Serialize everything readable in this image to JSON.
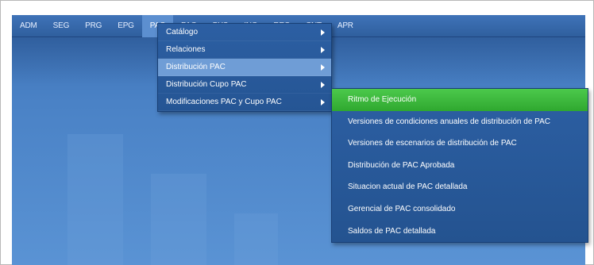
{
  "menubar": {
    "items": [
      {
        "label": "ADM"
      },
      {
        "label": "SEG"
      },
      {
        "label": "PRG"
      },
      {
        "label": "EPG"
      },
      {
        "label": "PAC"
      },
      {
        "label": "PAG"
      },
      {
        "label": "BYS"
      },
      {
        "label": "ING"
      },
      {
        "label": "REC"
      },
      {
        "label": "CNT"
      },
      {
        "label": "APR"
      }
    ],
    "active": "PAC"
  },
  "pac_menu": {
    "items": [
      {
        "label": "Catálogo"
      },
      {
        "label": "Relaciones"
      },
      {
        "label": "Distribución PAC"
      },
      {
        "label": "Distribución Cupo PAC"
      },
      {
        "label": "Modificaciones PAC y Cupo PAC"
      }
    ],
    "selected": "Distribución PAC"
  },
  "submenu": {
    "items": [
      {
        "label": "Ritmo de Ejecución"
      },
      {
        "label": "Versiones de condiciones anuales de distribución de PAC"
      },
      {
        "label": "Versiones de escenarios de distribución de PAC"
      },
      {
        "label": "Distribución de PAC Aprobada"
      },
      {
        "label": "Situacion actual de PAC detallada"
      },
      {
        "label": "Gerencial de PAC consolidado"
      },
      {
        "label": "Saldos de PAC detallada"
      }
    ],
    "highlighted": "Ritmo de Ejecución"
  },
  "colors": {
    "menubar": "#2f5f9e",
    "menu_background": "#2c5fa3",
    "selected_item": "#6f9dd6",
    "highlight_green": "#3db83d"
  }
}
